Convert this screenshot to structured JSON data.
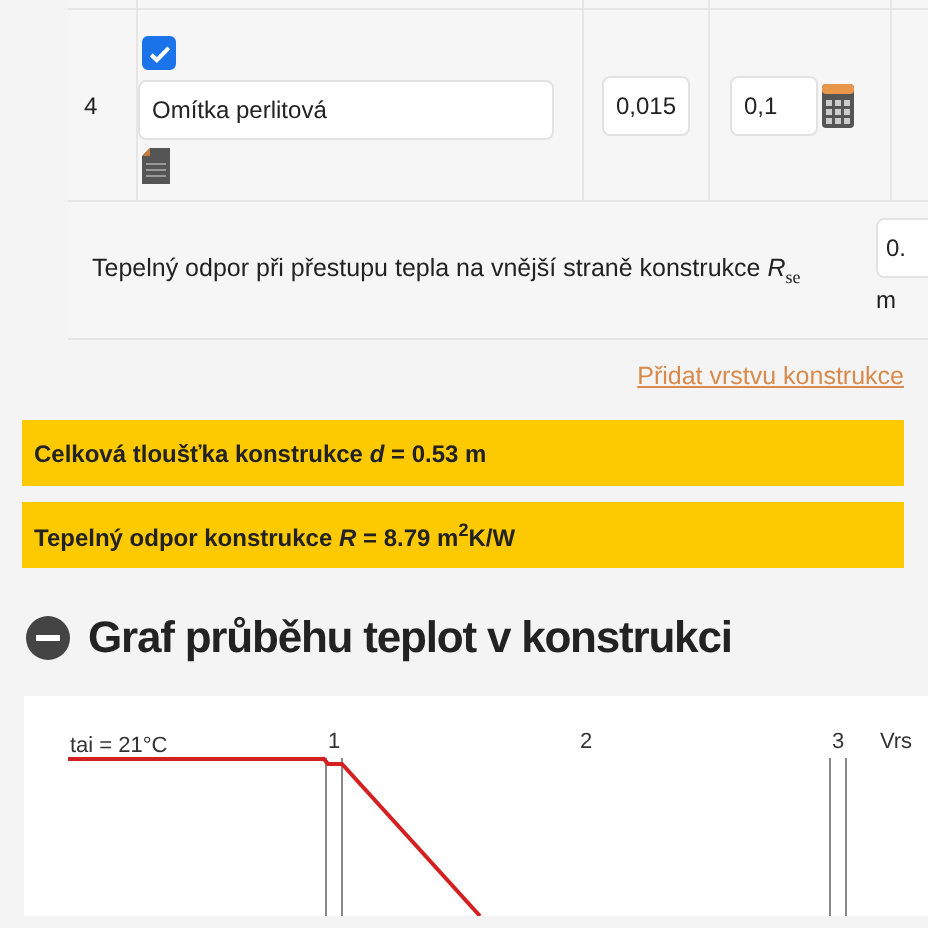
{
  "layers": [
    {
      "number": "4",
      "checked": true,
      "name": "Omítka perlitová",
      "thickness": "0,015",
      "lambda": "0,1"
    }
  ],
  "rse_row": {
    "label": "Tepelný odpor při přestupu tepla na vnější straně konstrukce *R*$_{se}$",
    "value": "0.",
    "unit": "m"
  },
  "add_layer_link": "Přidat vrstvu konstrukce",
  "results": [
    "Celková tloušťka konstrukce *d* = 0.53 m",
    "Tepelný odpor konstrukce *R* = 8.79 m$^{2}$K/W"
  ],
  "section": {
    "title": "Graf průběhu teplot v konstrukci",
    "expanded": true
  },
  "chart": {
    "interior_label": "tai = 21°C",
    "layer_labels": [
      "1",
      "2",
      "3",
      "Vrs"
    ]
  }
}
